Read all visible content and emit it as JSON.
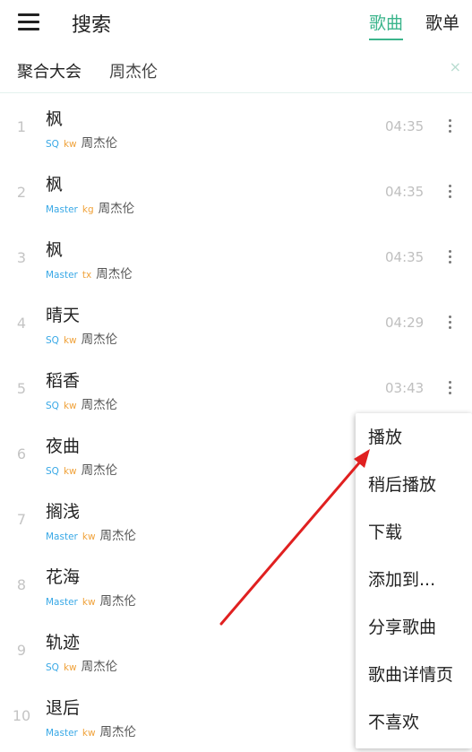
{
  "header": {
    "title": "搜索",
    "tabs": [
      {
        "label": "歌曲",
        "active": true
      },
      {
        "label": "歌单",
        "active": false
      }
    ]
  },
  "search": {
    "source": "聚合大会",
    "keyword": "周杰伦",
    "clear_icon": "×"
  },
  "songs": [
    {
      "index": "1",
      "title": "枫",
      "quality": "SQ",
      "source": "kw",
      "singer": "周杰伦",
      "duration": "04:35"
    },
    {
      "index": "2",
      "title": "枫",
      "quality": "Master",
      "source": "kg",
      "singer": "周杰伦",
      "duration": "04:35"
    },
    {
      "index": "3",
      "title": "枫",
      "quality": "Master",
      "source": "tx",
      "singer": "周杰伦",
      "duration": "04:35"
    },
    {
      "index": "4",
      "title": "晴天",
      "quality": "SQ",
      "source": "kw",
      "singer": "周杰伦",
      "duration": "04:29"
    },
    {
      "index": "5",
      "title": "稻香",
      "quality": "SQ",
      "source": "kw",
      "singer": "周杰伦",
      "duration": "03:43"
    },
    {
      "index": "6",
      "title": "夜曲",
      "quality": "SQ",
      "source": "kw",
      "singer": "周杰伦",
      "duration": ""
    },
    {
      "index": "7",
      "title": "搁浅",
      "quality": "Master",
      "source": "kw",
      "singer": "周杰伦",
      "duration": ""
    },
    {
      "index": "8",
      "title": "花海",
      "quality": "Master",
      "source": "kw",
      "singer": "周杰伦",
      "duration": ""
    },
    {
      "index": "9",
      "title": "轨迹",
      "quality": "SQ",
      "source": "kw",
      "singer": "周杰伦",
      "duration": ""
    },
    {
      "index": "10",
      "title": "退后",
      "quality": "Master",
      "source": "kw",
      "singer": "周杰伦",
      "duration": ""
    }
  ],
  "context_menu": {
    "items": [
      "播放",
      "稍后播放",
      "下载",
      "添加到...",
      "分享歌曲",
      "歌曲详情页",
      "不喜欢"
    ]
  },
  "colors": {
    "accent": "#3bb58c",
    "quality": "#38a8e6",
    "source": "#f0a23a",
    "annotation_arrow": "#e02020"
  },
  "icons": {
    "menu": "hamburger-menu-icon",
    "clear": "close-icon",
    "more": "more-vertical-icon",
    "annotation": "red-arrow-icon"
  }
}
